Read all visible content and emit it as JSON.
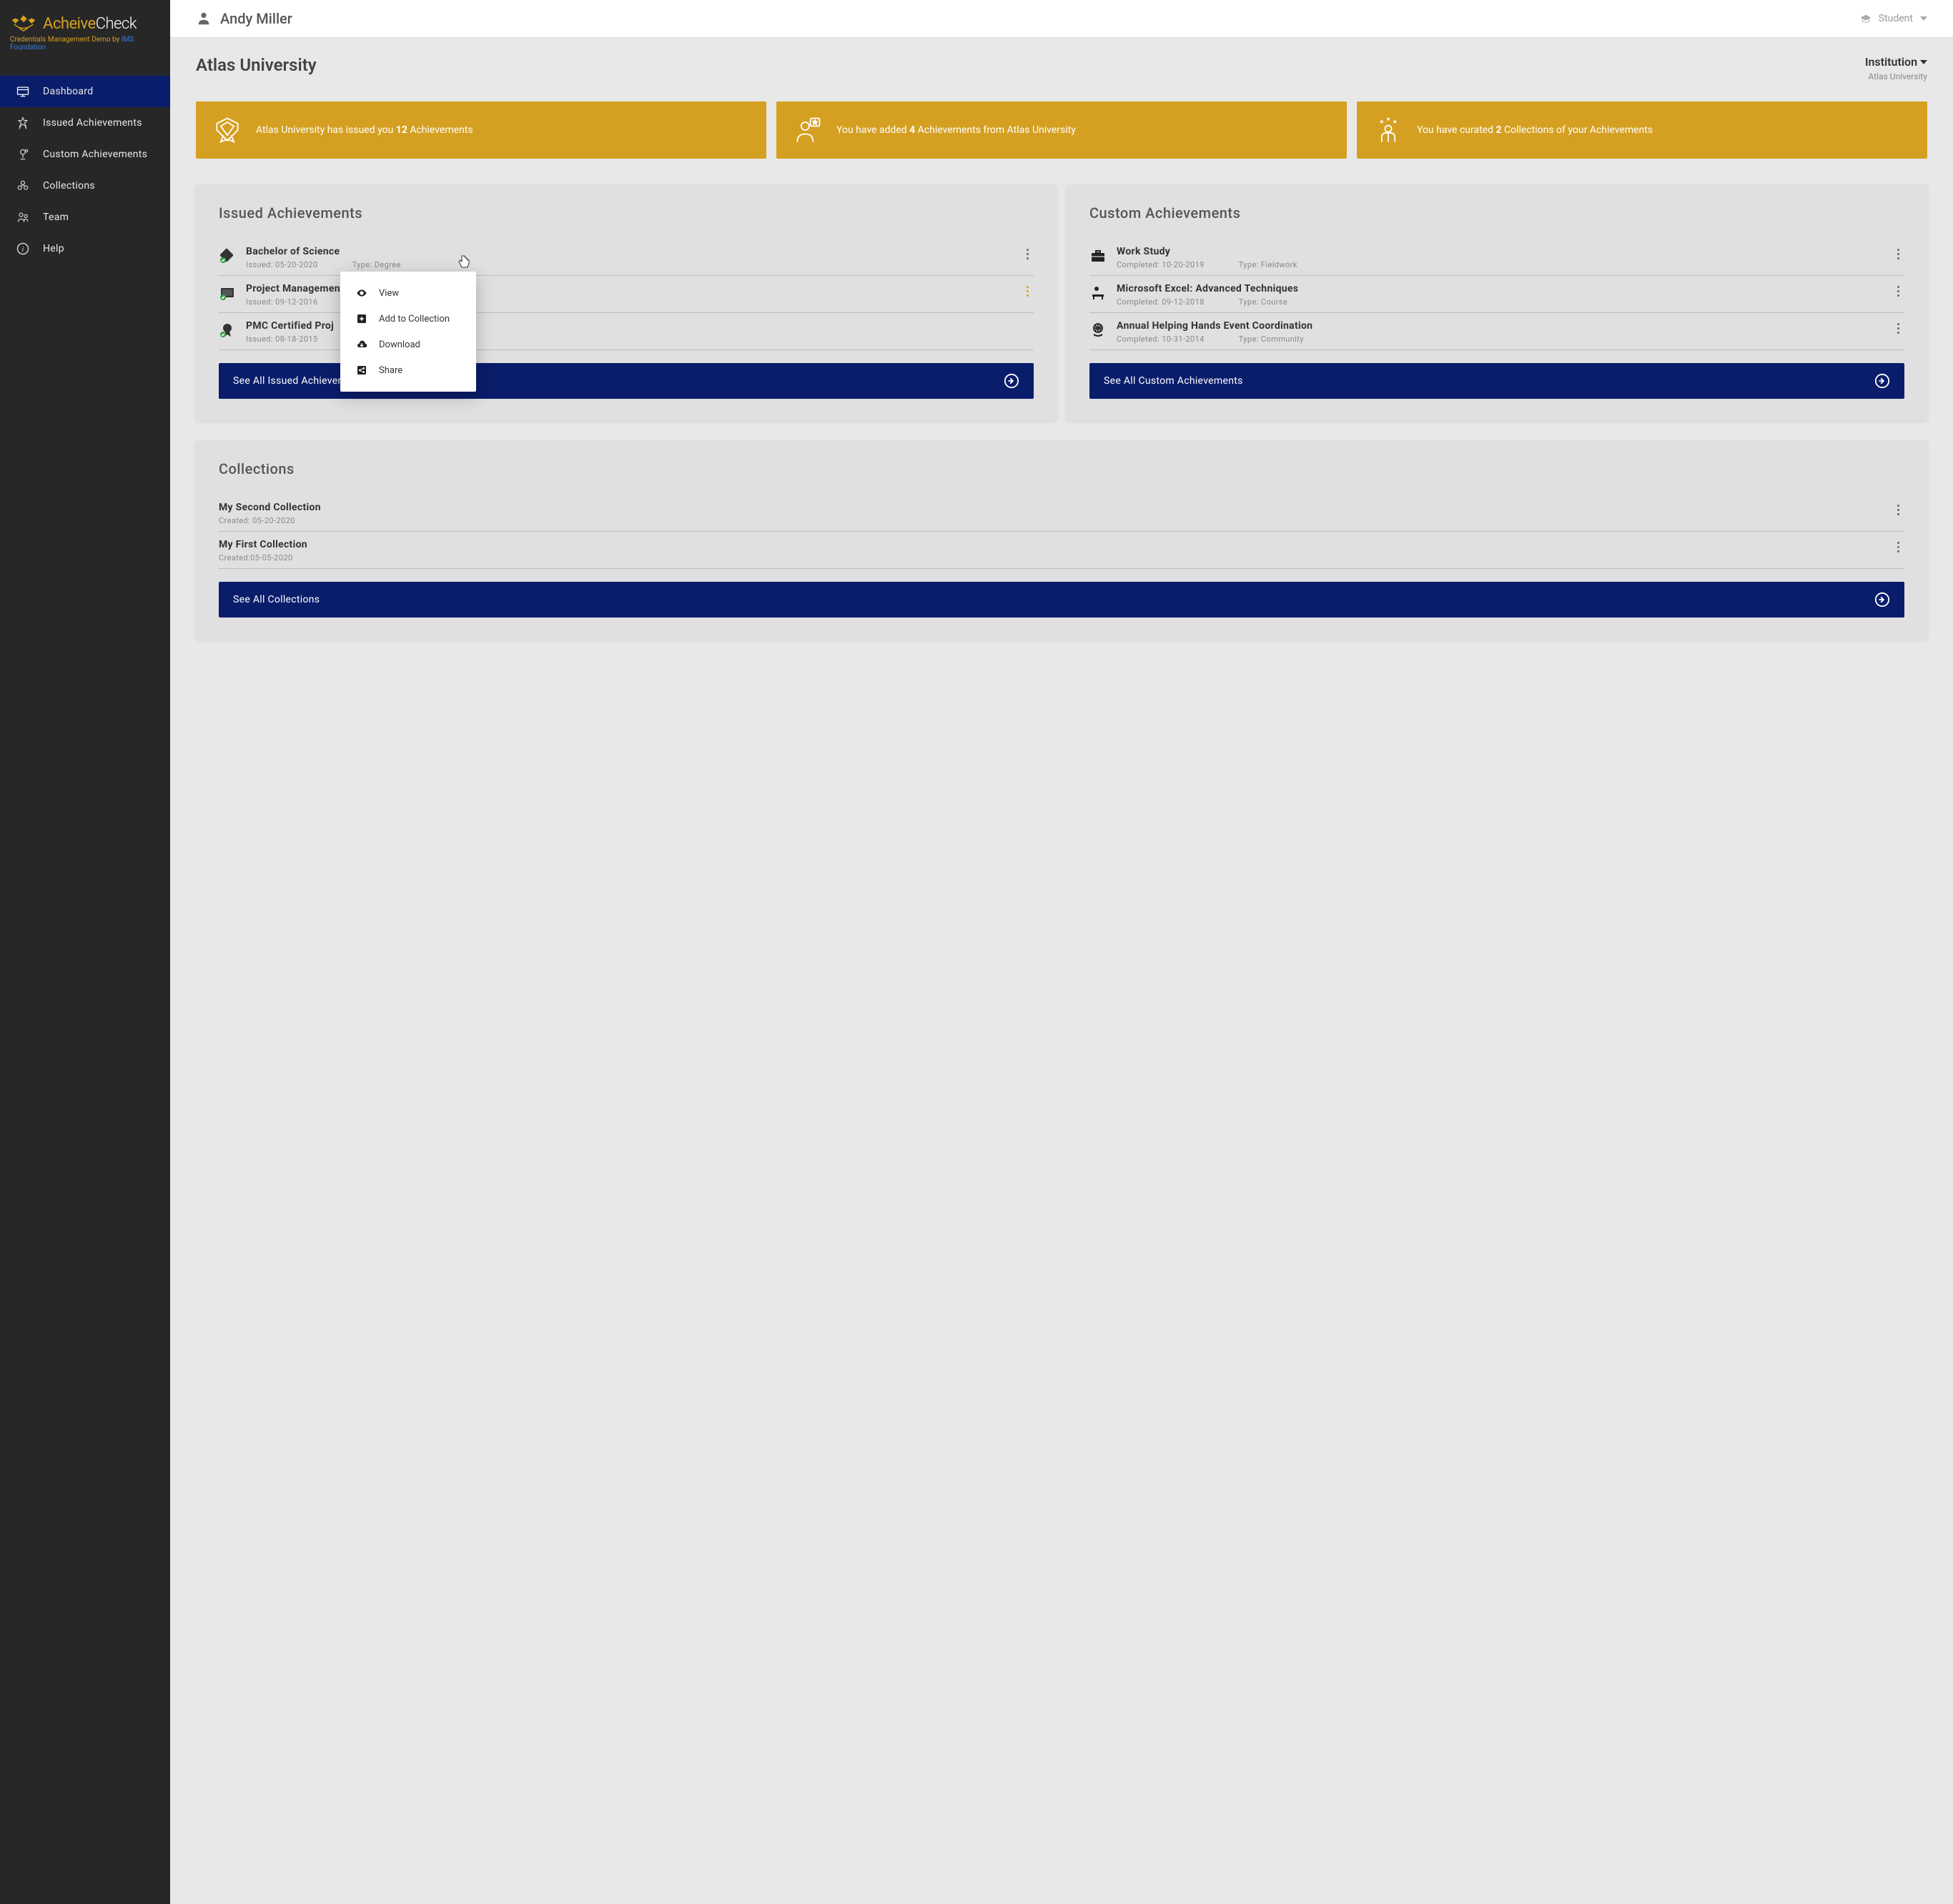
{
  "brand": {
    "name_part1": "Acheive",
    "name_part2": "Check",
    "subtitle_prefix": "Credentials Management Demo by ",
    "subtitle_link": "IMS Foundation"
  },
  "nav": {
    "items": [
      {
        "label": "Dashboard",
        "active": true
      },
      {
        "label": "Issued Achievements",
        "active": false
      },
      {
        "label": "Custom Achievements",
        "active": false
      },
      {
        "label": "Collections",
        "active": false
      },
      {
        "label": "Team",
        "active": false
      },
      {
        "label": "Help",
        "active": false
      }
    ]
  },
  "topbar": {
    "user_name": "Andy Miller",
    "role": "Student"
  },
  "header": {
    "title": "Atlas University",
    "institution_label": "Institution",
    "institution_name": "Atlas University"
  },
  "stats": [
    {
      "pre": "Atlas University has issued you ",
      "bold": "12",
      "post": " Achievements"
    },
    {
      "pre": "You have added ",
      "bold": "4",
      "post": " Achievements from Atlas University"
    },
    {
      "pre": "You have curated ",
      "bold": "2",
      "post": " Collections of your Achievements"
    }
  ],
  "issued": {
    "title": "Issued Achievements",
    "see_all": "See All Issued Achievements",
    "items": [
      {
        "title": "Bachelor of Science",
        "date_label": "Issued: 05-20-2020",
        "type_label": "Type: Degree"
      },
      {
        "title": "Project Management Introductory ...",
        "date_label": "Issued: 09-12-2016",
        "type_label": ""
      },
      {
        "title": "PMC Certified Proj",
        "date_label": "Issued: 08-18-2015",
        "type_label": ""
      }
    ]
  },
  "custom": {
    "title": "Custom Achievements",
    "see_all": "See All Custom Achievements",
    "items": [
      {
        "title": "Work Study",
        "date_label": "Completed: 10-20-2019",
        "type_label": "Type: Fieldwork"
      },
      {
        "title": "Microsoft Excel: Advanced Techniques",
        "date_label": "Completed: 09-12-2018",
        "type_label": "Type: Course"
      },
      {
        "title": "Annual Helping Hands Event Coordination",
        "date_label": "Completed: 10-31-2014",
        "type_label": "Type: Community"
      }
    ]
  },
  "collections": {
    "title": "Collections",
    "see_all": "See All Collections",
    "items": [
      {
        "title": "My Second Collection",
        "meta": "Created: 05-20-2020"
      },
      {
        "title": "My First Collection",
        "meta": "Created:05-05-2020"
      }
    ]
  },
  "context_menu": {
    "view": "View",
    "add": "Add to Collection",
    "download": "Download",
    "share": "Share"
  }
}
